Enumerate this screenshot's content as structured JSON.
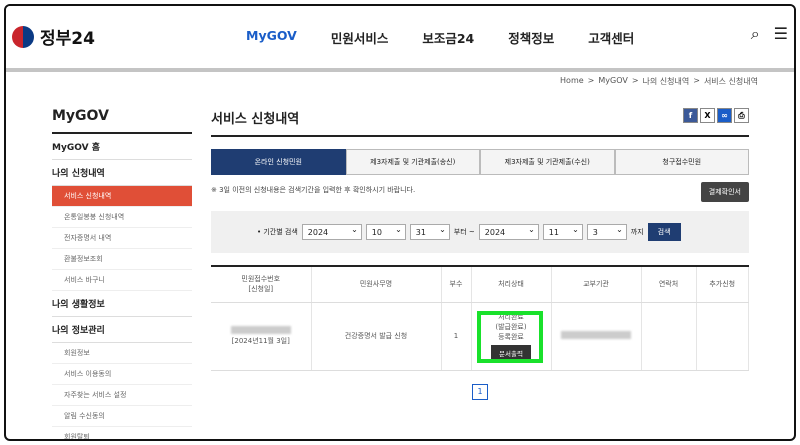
{
  "logo": "정부24",
  "gnb": [
    "MyGOV",
    "민원서비스",
    "보조금24",
    "정책정보",
    "고객센터"
  ],
  "breadcrumb": [
    "Home",
    ">",
    "MyGOV",
    ">",
    "나의 신청내역",
    ">",
    "서비스 신청내역"
  ],
  "snb": {
    "title": "MyGOV",
    "home": "MyGOV 홈",
    "mine": "나의 신청내역",
    "sub1": [
      "서비스 신청내역",
      "온통일봉봉 신청내역",
      "전자증명서 내역",
      "환불정보조회",
      "서비스 바구니"
    ],
    "life": "나의 생활정보",
    "manage": "나의 정보관리",
    "sub2": [
      "회원정보",
      "서비스 이용동의",
      "자주찾는 서비스 설정",
      "알림 수신동의",
      "회원탈퇴"
    ]
  },
  "main": {
    "title": "서비스 신청내역",
    "tabs": [
      "온라인 신청민원",
      "제3자제출 및 기관제출(송신)",
      "제3자제출 및 기관제출(수신)",
      "청구접수민원"
    ],
    "note": "※ 3일 이전의 신청내용은 검색기간을 입력한 후 확인하시기 바랍니다.",
    "confirm_btn": "결제확인서",
    "search_label": "• 기간별 검색",
    "from": [
      "2024",
      "10",
      "31"
    ],
    "from_suffix": "부터 ~",
    "to": [
      "2024",
      "11",
      "3"
    ],
    "to_suffix": "까지",
    "search_btn": "검색"
  },
  "table": {
    "headers": [
      "민원접수번호\n[신청일]",
      "민원사무명",
      "부수",
      "처리상태",
      "교부기관",
      "연락처",
      "추가신청"
    ],
    "date": "[2024년11월 3일]",
    "name": "건강증명서 발급 신청",
    "copies": "1",
    "status": "처리완료\n(발급완료)\n등록완료",
    "print_btn": "문서출력"
  },
  "pager": "1"
}
